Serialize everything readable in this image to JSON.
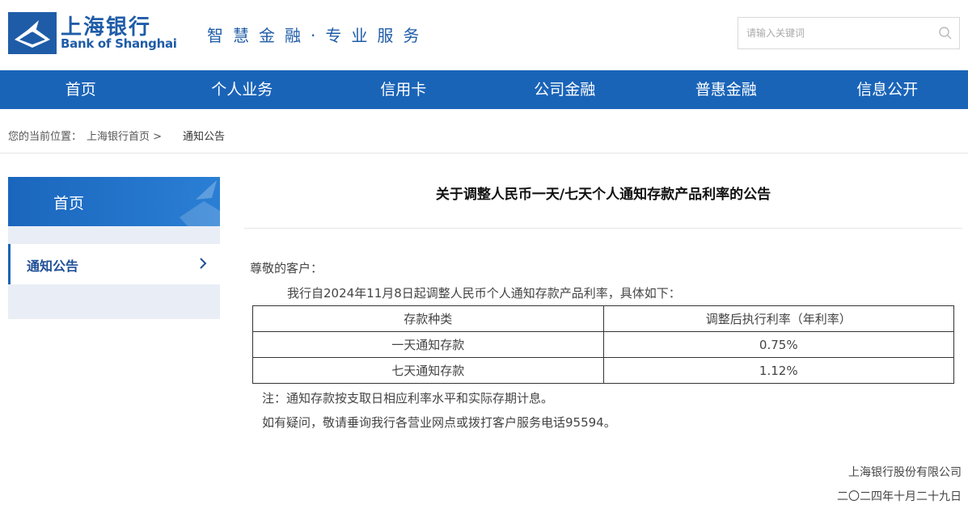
{
  "header": {
    "brand_cn": "上海银行",
    "brand_en": "Bank of Shanghai",
    "slogan": "智慧金融·专业服务",
    "search_placeholder": "请输入关键词"
  },
  "nav": {
    "items": [
      {
        "label": "首页"
      },
      {
        "label": "个人业务"
      },
      {
        "label": "信用卡"
      },
      {
        "label": "公司金融"
      },
      {
        "label": "普惠金融"
      },
      {
        "label": "信息公开"
      }
    ]
  },
  "breadcrumb": {
    "prefix": "您的当前位置：",
    "home": "上海银行首页 >",
    "current": "通知公告"
  },
  "sidebar": {
    "head": "首页",
    "item": "通知公告"
  },
  "article": {
    "title": "关于调整人民币一天/七天个人通知存款产品利率的公告",
    "greeting": "尊敬的客户：",
    "intro": "我行自2024年11月8日起调整人民币个人通知存款产品利率，具体如下：",
    "table": {
      "headers": [
        "存款种类",
        "调整后执行利率（年利率）"
      ],
      "rows": [
        [
          "一天通知存款",
          "0.75%"
        ],
        [
          "七天通知存款",
          "1.12%"
        ]
      ]
    },
    "note": "注：通知存款按支取日相应利率水平和实际存期计息。",
    "contact": "如有疑问，敬请垂询我行各营业网点或拨打客户服务电话95594。",
    "issuer": "上海银行股份有限公司",
    "date": "二〇二四年十月二十九日"
  },
  "colors": {
    "nav_bg": "#1a64b8",
    "brand": "#1f5ca8",
    "side_bg": "#e9eef6"
  }
}
